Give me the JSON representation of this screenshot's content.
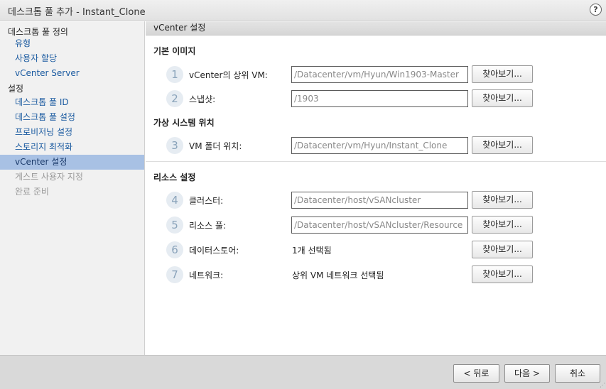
{
  "window": {
    "title": "데스크톱 풀 추가 - Instant_Clone",
    "help_label": "?"
  },
  "sidebar": {
    "group1": "데스크톱 풀 정의",
    "group1_items": [
      {
        "label": "유형"
      },
      {
        "label": "사용자 할당"
      },
      {
        "label": "vCenter Server"
      }
    ],
    "group2": "설정",
    "group2_items": [
      {
        "label": "데스크톱 풀 ID"
      },
      {
        "label": "데스크톱 풀 설정"
      },
      {
        "label": "프로비저닝 설정"
      },
      {
        "label": "스토리지 최적화"
      },
      {
        "label": "vCenter 설정",
        "state": "active"
      },
      {
        "label": "게스트 사용자 지정",
        "state": "disabled"
      },
      {
        "label": "완료 준비",
        "state": "disabled"
      }
    ]
  },
  "main": {
    "header": "vCenter 설정",
    "sections": {
      "base_image": "기본 이미지",
      "vm_location": "가상 시스템 위치",
      "resources": "리소스 설정"
    },
    "rows": [
      {
        "num": "1",
        "label": "vCenter의 상위 VM:",
        "value": "/Datacenter/vm/Hyun/Win1903-Master",
        "button": "찾아보기..."
      },
      {
        "num": "2",
        "label": "스냅샷:",
        "value": "/1903",
        "button": "찾아보기..."
      },
      {
        "num": "3",
        "label": "VM 폴더 위치:",
        "value": "/Datacenter/vm/Hyun/Instant_Clone",
        "button": "찾아보기..."
      },
      {
        "num": "4",
        "label": "클러스터:",
        "value": "/Datacenter/host/vSANcluster",
        "button": "찾아보기..."
      },
      {
        "num": "5",
        "label": "리소스 풀:",
        "value": "/Datacenter/host/vSANcluster/Resource",
        "button": "찾아보기..."
      },
      {
        "num": "6",
        "label": "데이터스토어:",
        "value": "1개 선택됨",
        "button": "찾아보기..."
      },
      {
        "num": "7",
        "label": "네트워크:",
        "value": "상위 VM 네트워크 선택됨",
        "button": "찾아보기..."
      }
    ]
  },
  "footer": {
    "back": "< 뒤로",
    "next": "다음 >",
    "cancel": "취소"
  }
}
